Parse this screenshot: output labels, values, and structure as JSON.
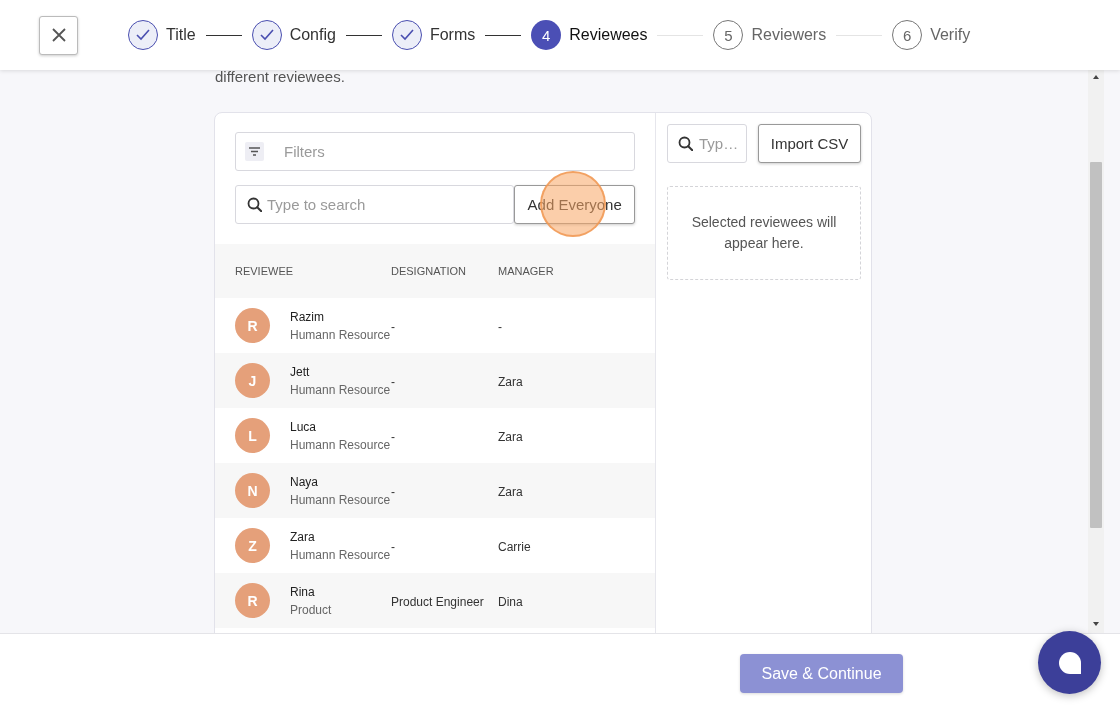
{
  "steps": [
    {
      "label": "Title",
      "completed": true,
      "selected": false
    },
    {
      "label": "Config",
      "completed": true,
      "selected": false
    },
    {
      "label": "Forms",
      "completed": true,
      "selected": false
    },
    {
      "label": "Reviewees",
      "number": "4",
      "completed": false,
      "selected": true
    },
    {
      "label": "Reviewers",
      "number": "5",
      "completed": false,
      "selected": false
    },
    {
      "label": "Verify",
      "number": "6",
      "completed": false,
      "selected": false
    }
  ],
  "intro_text": "different reviewees.",
  "filters": {
    "placeholder": "Filters"
  },
  "search": {
    "placeholder": "Type to search"
  },
  "add_button": {
    "label": "Add Everyone",
    "highlighted": true
  },
  "table": {
    "columns": [
      "REVIEWEE",
      "DESIGNATION",
      "MANAGER"
    ],
    "rows": [
      {
        "initial": "R",
        "name": "Razim",
        "department": "Humann Resource",
        "designation": "-",
        "manager": "-"
      },
      {
        "initial": "J",
        "name": "Jett",
        "department": "Humann Resource",
        "designation": "-",
        "manager": "Zara"
      },
      {
        "initial": "L",
        "name": "Luca",
        "department": "Humann Resource",
        "designation": "-",
        "manager": "Zara"
      },
      {
        "initial": "N",
        "name": "Naya",
        "department": "Humann Resource",
        "designation": "-",
        "manager": "Zara"
      },
      {
        "initial": "Z",
        "name": "Zara",
        "department": "Humann Resource",
        "designation": "-",
        "manager": "Carrie"
      },
      {
        "initial": "R",
        "name": "Rina",
        "department": "Product",
        "designation": "Product Engineer",
        "manager": "Dina"
      }
    ]
  },
  "selected_panel": {
    "search": {
      "placeholder": "Typ…"
    },
    "import_button": "Import CSV",
    "empty_text": "Selected reviewees will appear here."
  },
  "footer": {
    "save_button": "Save & Continue"
  }
}
